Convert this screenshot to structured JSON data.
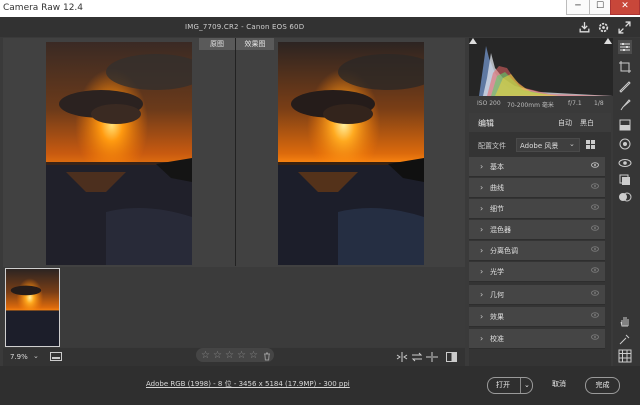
{
  "window": {
    "app_title": "Camera Raw 12.4",
    "min_label": "─",
    "max_label": "☐",
    "close_label": "✕"
  },
  "header": {
    "file_title": "IMG_7709.CR2 - Canon EOS 60D"
  },
  "view": {
    "before_label": "原图",
    "after_label": "效果图"
  },
  "bottom": {
    "zoom": "7.9%"
  },
  "status": {
    "file_info": "Adobe RGB (1998) - 8 位 - 3456 x 5184 (17.9MP) - 300 ppi",
    "open_label": "打开",
    "cancel_label": "取消",
    "done_label": "完成"
  },
  "exif": {
    "iso": "ISO 200",
    "lens": "70-200mm 毫米",
    "aperture": "f/7.1",
    "shutter": "1/8"
  },
  "panel": {
    "edit_label": "编辑",
    "auto_label": "自动",
    "bw_label": "黑白",
    "profile_label": "配置文件",
    "profile_value": "Adobe 风景",
    "sections": [
      "基本",
      "曲线",
      "细节",
      "混色器",
      "分离色调",
      "光学",
      "几何",
      "效果",
      "校准"
    ]
  },
  "colors": {
    "accent": "#ffa500",
    "panel": "#343434",
    "section": "#454545"
  }
}
